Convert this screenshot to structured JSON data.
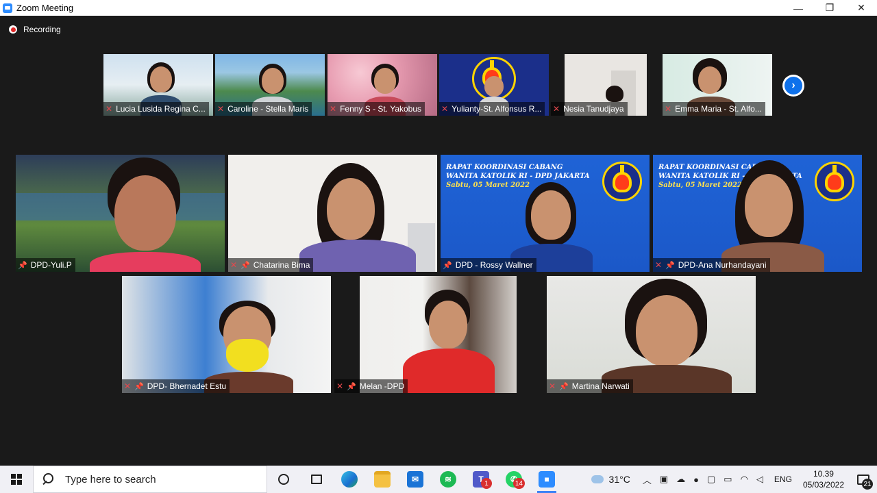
{
  "window": {
    "title": "Zoom Meeting",
    "controls": {
      "minimize": "—",
      "restore": "❐",
      "close": "✕"
    }
  },
  "recording": {
    "label": "Recording"
  },
  "thumbnails": [
    {
      "name": "Lucia Lusida Regina C...",
      "muted": true
    },
    {
      "name": "Caroline - Stella Maris",
      "muted": true
    },
    {
      "name": "Fenny S - St. Yakobus",
      "muted": true
    },
    {
      "name": "Yulianty-St. Alfonsus R...",
      "muted": true
    },
    {
      "name": "Nesia Tanudjaya",
      "muted": true
    },
    {
      "name": "Emma Maria - St. Alfo...",
      "muted": true
    }
  ],
  "gallery": [
    {
      "name": "DPD-Yuli.P",
      "muted": false,
      "pinned": true
    },
    {
      "name": "Chatarina Bima",
      "muted": true,
      "pinned": true
    },
    {
      "name": "DPD - Rossy Wallner",
      "muted": false,
      "pinned": true
    },
    {
      "name": "DPD-Ana Nurhandayani",
      "muted": true,
      "pinned": true
    },
    {
      "name": "DPD- Bhernadet Estu",
      "muted": true,
      "pinned": true
    },
    {
      "name": "Melan -DPD",
      "muted": true,
      "pinned": true
    },
    {
      "name": "Martina Narwati",
      "muted": true,
      "pinned": true
    }
  ],
  "virtual_background_banner": {
    "line1": "RAPAT KOORDINASI CABANG",
    "line2": "WANITA KATOLIK RI - DPD JAKARTA",
    "line3": "Sabtu, 05 Maret 2022"
  },
  "taskbar": {
    "search_placeholder": "Type here to search",
    "apps": [
      {
        "icon": "task-view-icon"
      },
      {
        "icon": "multitasking-icon"
      },
      {
        "icon": "edge-icon"
      },
      {
        "icon": "file-explorer-icon"
      },
      {
        "icon": "mail-icon"
      },
      {
        "icon": "spotify-icon"
      },
      {
        "icon": "teams-icon",
        "badge": "1"
      },
      {
        "icon": "whatsapp-icon",
        "badge": "14"
      },
      {
        "icon": "zoom-icon",
        "active": true
      }
    ],
    "weather": "31°C",
    "language": "ENG",
    "time": "10.39",
    "date": "05/03/2022",
    "notifications": "21"
  }
}
